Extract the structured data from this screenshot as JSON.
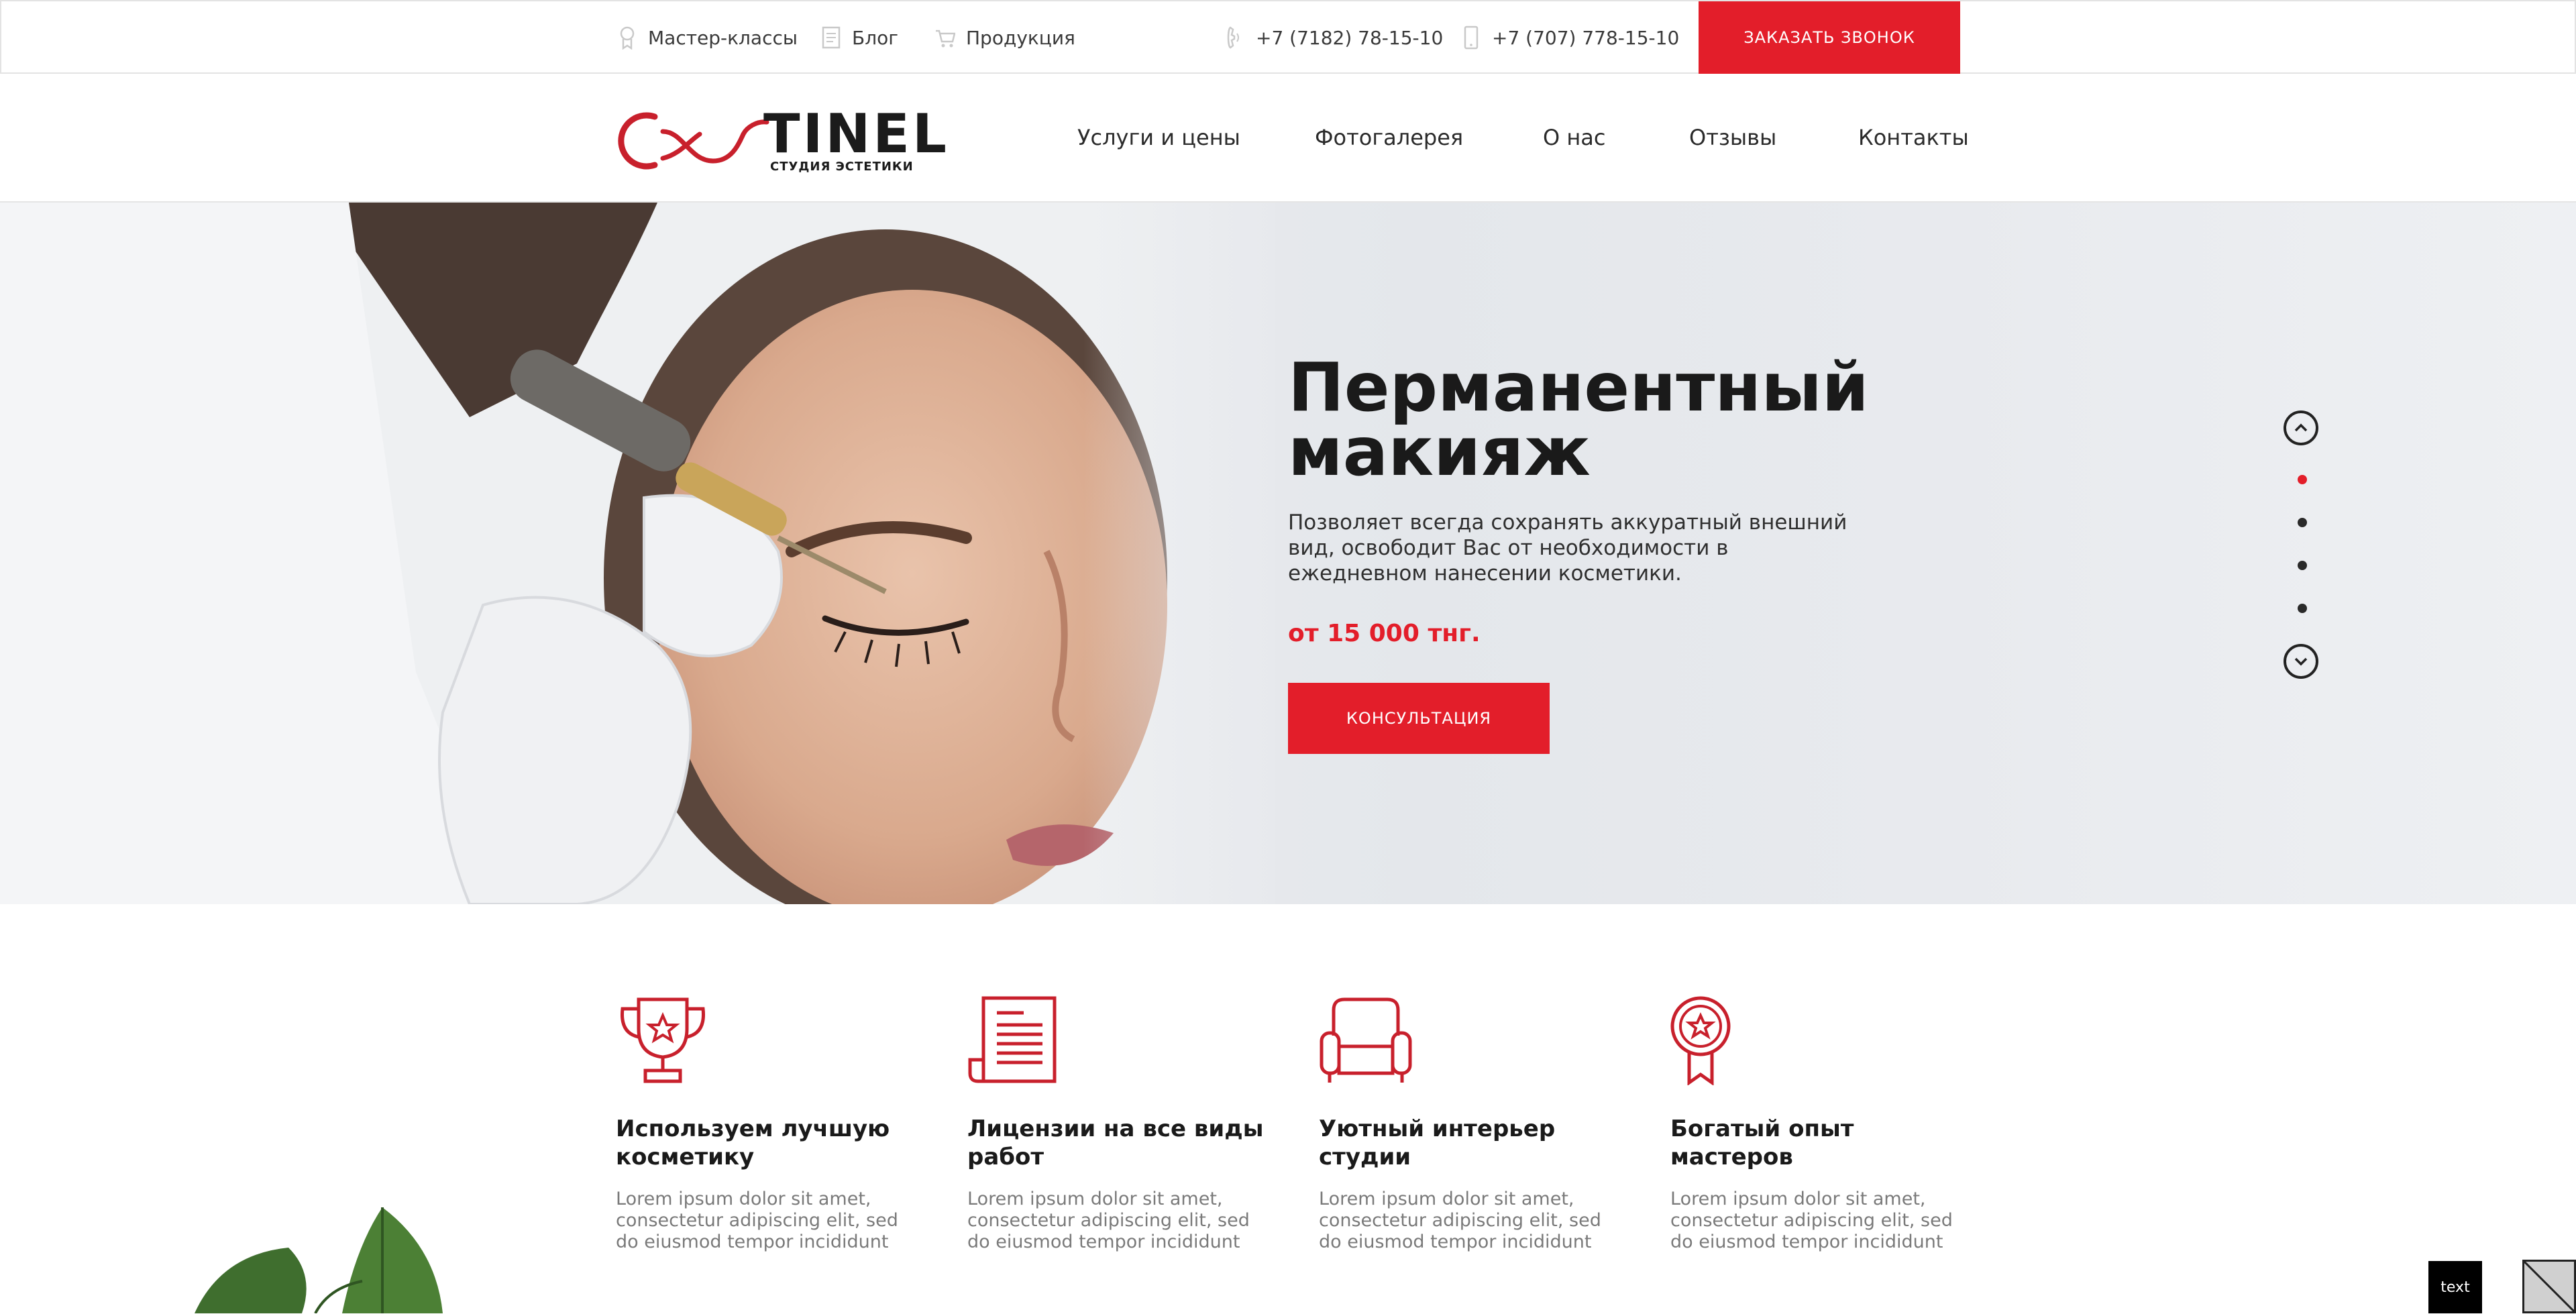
{
  "topbar": {
    "links": [
      {
        "label": "Мастер-классы",
        "icon": "master-class-icon"
      },
      {
        "label": "Блог",
        "icon": "blog-icon"
      },
      {
        "label": "Продукция",
        "icon": "cart-icon"
      }
    ],
    "phones": [
      "+7 (7182) 78-15-10",
      "+7 (707) 778-15-10"
    ],
    "call_button": "ЗАКАЗАТЬ ЗВОНОК"
  },
  "logo": {
    "text": "TINEL",
    "subtitle": "СТУДИЯ ЭСТЕТИКИ"
  },
  "nav": {
    "items": [
      "Услуги и цены",
      "Фотогалерея",
      "О нас",
      "Отзывы",
      "Контакты"
    ]
  },
  "hero": {
    "title": "Перманентный макияж",
    "description": "Позволяет всегда сохранять аккуратный внешний вид, освободит Вас от необходимости в ежедневном нанесении косметики.",
    "price": "от 15 000 тнг.",
    "button": "КОНСУЛЬТАЦИЯ",
    "slides_total": 4,
    "active_slide": 1
  },
  "features": [
    {
      "icon": "trophy-icon",
      "title": "Используем лучшую косметику",
      "text": "Lorem ipsum dolor sit amet, consectetur adipiscing elit, sed do eiusmod tempor incididunt"
    },
    {
      "icon": "license-document-icon",
      "title": "Лицензии на все виды работ",
      "text": "Lorem ipsum dolor sit amet, consectetur adipiscing elit, sed do eiusmod tempor incididunt"
    },
    {
      "icon": "armchair-icon",
      "title": "Уютный интерьер студии",
      "text": "Lorem ipsum dolor sit amet, consectetur adipiscing elit, sed do eiusmod tempor incididunt"
    },
    {
      "icon": "award-medal-icon",
      "title": "Богатый опыт мастеров",
      "text": "Lorem ipsum dolor sit amet, consectetur adipiscing elit, sed do eiusmod tempor incididunt"
    }
  ],
  "badge": {
    "text": "text"
  },
  "colors": {
    "accent": "#e31e2a",
    "dark": "#1a1a1a"
  }
}
